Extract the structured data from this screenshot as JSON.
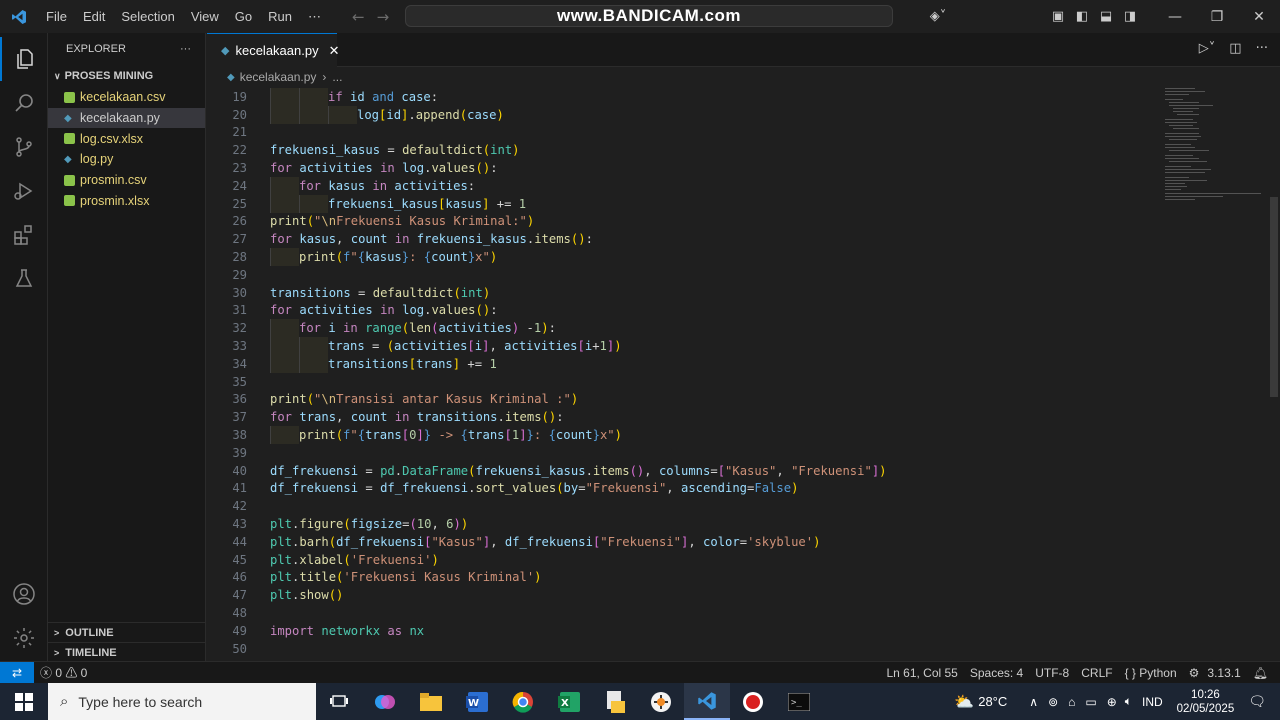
{
  "titlebar": {
    "menu": [
      "File",
      "Edit",
      "Selection",
      "View",
      "Go",
      "Run",
      "⋯"
    ],
    "command_center": "www.BANDICAM.com"
  },
  "sidebar": {
    "title": "EXPLORER",
    "folder": "PROSES MINING",
    "files": [
      {
        "name": "kecelakaan.csv",
        "type": "csv"
      },
      {
        "name": "kecelakaan.py",
        "type": "py",
        "selected": true
      },
      {
        "name": "log.csv.xlsx",
        "type": "xlsx"
      },
      {
        "name": "log.py",
        "type": "py"
      },
      {
        "name": "prosmin.csv",
        "type": "csv"
      },
      {
        "name": "prosmin.xlsx",
        "type": "xlsx"
      }
    ],
    "outline": "OUTLINE",
    "timeline": "TIMELINE"
  },
  "tab": {
    "label": "kecelakaan.py"
  },
  "breadcrumb": {
    "file": "kecelakaan.py",
    "more": "..."
  },
  "editor": {
    "lines": [
      {
        "n": "19",
        "indent": 2,
        "html": "<span class=\"ctl\">if</span> <span class=\"var\">id</span> <span class=\"bool\">and</span> <span class=\"var\">case</span>:"
      },
      {
        "n": "20",
        "indent": 3,
        "html": "<span class=\"var\">log</span><span class=\"br\">[</span><span class=\"var\">id</span><span class=\"br\">]</span>.<span class=\"fn\">append</span><span class=\"br\">(</span><span class=\"var\">case</span><span class=\"br\">)</span>"
      },
      {
        "n": "21",
        "indent": 0,
        "html": ""
      },
      {
        "n": "22",
        "indent": 0,
        "html": "<span class=\"var\">frekuensi_kasus</span> = <span class=\"fn\">defaultdict</span><span class=\"br\">(</span><span class=\"cls\">int</span><span class=\"br\">)</span>"
      },
      {
        "n": "23",
        "indent": 0,
        "html": "<span class=\"ctl\">for</span> <span class=\"var\">activities</span> <span class=\"ctl\">in</span> <span class=\"var\">log</span>.<span class=\"fn\">values</span><span class=\"br\">()</span>:"
      },
      {
        "n": "24",
        "indent": 1,
        "html": "<span class=\"ctl\">for</span> <span class=\"var\">kasus</span> <span class=\"ctl\">in</span> <span class=\"var\">activities</span>:"
      },
      {
        "n": "25",
        "indent": 2,
        "html": "<span class=\"var\">frekuensi_kasus</span><span class=\"br\">[</span><span class=\"var\">kasus</span><span class=\"br\">]</span> += <span class=\"num\">1</span>"
      },
      {
        "n": "26",
        "indent": 0,
        "html": "<span class=\"fn\">print</span><span class=\"br\">(</span><span class=\"str\">\"</span><span class=\"esc\">\\n</span><span class=\"str\">Frekuensi Kasus Kriminal:\"</span><span class=\"br\">)</span>"
      },
      {
        "n": "27",
        "indent": 0,
        "html": "<span class=\"ctl\">for</span> <span class=\"var\">kasus</span>, <span class=\"var\">count</span> <span class=\"ctl\">in</span> <span class=\"var\">frekuensi_kasus</span>.<span class=\"fn\">items</span><span class=\"br\">()</span>:"
      },
      {
        "n": "28",
        "indent": 1,
        "html": "<span class=\"fn\">print</span><span class=\"br\">(</span><span class=\"bool\">f</span><span class=\"str\">\"</span><span class=\"bool\">{</span><span class=\"var\">kasus</span><span class=\"bool\">}</span><span class=\"str\">: </span><span class=\"bool\">{</span><span class=\"var\">count</span><span class=\"bool\">}</span><span class=\"str\">x\"</span><span class=\"br\">)</span>"
      },
      {
        "n": "29",
        "indent": 0,
        "html": ""
      },
      {
        "n": "30",
        "indent": 0,
        "html": "<span class=\"var\">transitions</span> = <span class=\"fn\">defaultdict</span><span class=\"br\">(</span><span class=\"cls\">int</span><span class=\"br\">)</span>"
      },
      {
        "n": "31",
        "indent": 0,
        "html": "<span class=\"ctl\">for</span> <span class=\"var\">activities</span> <span class=\"ctl\">in</span> <span class=\"var\">log</span>.<span class=\"fn\">values</span><span class=\"br\">()</span>:"
      },
      {
        "n": "32",
        "indent": 1,
        "html": "<span class=\"ctl\">for</span> <span class=\"var\">i</span> <span class=\"ctl\">in</span> <span class=\"cls\">range</span><span class=\"br\">(</span><span class=\"fn\">len</span><span class=\"br2\">(</span><span class=\"var\">activities</span><span class=\"br2\">)</span> -<span class=\"num\">1</span><span class=\"br\">)</span>:"
      },
      {
        "n": "33",
        "indent": 2,
        "html": "<span class=\"var\">trans</span> = <span class=\"br\">(</span><span class=\"var\">activities</span><span class=\"br2\">[</span><span class=\"var\">i</span><span class=\"br2\">]</span>, <span class=\"var\">activities</span><span class=\"br2\">[</span><span class=\"var\">i</span>+<span class=\"num\">1</span><span class=\"br2\">]</span><span class=\"br\">)</span>"
      },
      {
        "n": "34",
        "indent": 2,
        "html": "<span class=\"var\">transitions</span><span class=\"br\">[</span><span class=\"var\">trans</span><span class=\"br\">]</span> += <span class=\"num\">1</span>"
      },
      {
        "n": "35",
        "indent": 0,
        "html": ""
      },
      {
        "n": "36",
        "indent": 0,
        "html": "<span class=\"fn\">print</span><span class=\"br\">(</span><span class=\"str\">\"</span><span class=\"esc\">\\n</span><span class=\"str\">Transisi antar Kasus Kriminal :\"</span><span class=\"br\">)</span>"
      },
      {
        "n": "37",
        "indent": 0,
        "html": "<span class=\"ctl\">for</span> <span class=\"var\">trans</span>, <span class=\"var\">count</span> <span class=\"ctl\">in</span> <span class=\"var\">transitions</span>.<span class=\"fn\">items</span><span class=\"br\">()</span>:"
      },
      {
        "n": "38",
        "indent": 1,
        "html": "<span class=\"fn\">print</span><span class=\"br\">(</span><span class=\"bool\">f</span><span class=\"str\">\"</span><span class=\"bool\">{</span><span class=\"var\">trans</span><span class=\"br2\">[</span><span class=\"num\">0</span><span class=\"br2\">]</span><span class=\"bool\">}</span><span class=\"str\"> -&gt; </span><span class=\"bool\">{</span><span class=\"var\">trans</span><span class=\"br2\">[</span><span class=\"num\">1</span><span class=\"br2\">]</span><span class=\"bool\">}</span><span class=\"str\">: </span><span class=\"bool\">{</span><span class=\"var\">count</span><span class=\"bool\">}</span><span class=\"str\">x\"</span><span class=\"br\">)</span>"
      },
      {
        "n": "39",
        "indent": 0,
        "html": ""
      },
      {
        "n": "40",
        "indent": 0,
        "html": "<span class=\"var\">df_frekuensi</span> = <span class=\"cls\">pd</span>.<span class=\"cls\">DataFrame</span><span class=\"br\">(</span><span class=\"var\">frekuensi_kasus</span>.<span class=\"fn\">items</span><span class=\"br2\">()</span>, <span class=\"var\">columns</span>=<span class=\"br2\">[</span><span class=\"str\">\"Kasus\"</span>, <span class=\"str\">\"Frekuensi\"</span><span class=\"br2\">]</span><span class=\"br\">)</span>"
      },
      {
        "n": "41",
        "indent": 0,
        "html": "<span class=\"var\">df_frekuensi</span> = <span class=\"var\">df_frekuensi</span>.<span class=\"fn\">sort_values</span><span class=\"br\">(</span><span class=\"var\">by</span>=<span class=\"str\">\"Frekuensi\"</span>, <span class=\"var\">ascending</span>=<span class=\"bool\">False</span><span class=\"br\">)</span>"
      },
      {
        "n": "42",
        "indent": 0,
        "html": ""
      },
      {
        "n": "43",
        "indent": 0,
        "html": "<span class=\"cls\">plt</span>.<span class=\"fn\">figure</span><span class=\"br\">(</span><span class=\"var\">figsize</span>=<span class=\"br2\">(</span><span class=\"num\">10</span>, <span class=\"num\">6</span><span class=\"br2\">)</span><span class=\"br\">)</span>"
      },
      {
        "n": "44",
        "indent": 0,
        "html": "<span class=\"cls\">plt</span>.<span class=\"fn\">barh</span><span class=\"br\">(</span><span class=\"var\">df_frekuensi</span><span class=\"br2\">[</span><span class=\"str\">\"Kasus\"</span><span class=\"br2\">]</span>, <span class=\"var\">df_frekuensi</span><span class=\"br2\">[</span><span class=\"str\">\"Frekuensi\"</span><span class=\"br2\">]</span>, <span class=\"var\">color</span>=<span class=\"str\">'skyblue'</span><span class=\"br\">)</span>"
      },
      {
        "n": "45",
        "indent": 0,
        "html": "<span class=\"cls\">plt</span>.<span class=\"fn\">xlabel</span><span class=\"br\">(</span><span class=\"str\">'Frekuensi'</span><span class=\"br\">)</span>"
      },
      {
        "n": "46",
        "indent": 0,
        "html": "<span class=\"cls\">plt</span>.<span class=\"fn\">title</span><span class=\"br\">(</span><span class=\"str\">'Frekuensi Kasus Kriminal'</span><span class=\"br\">)</span>"
      },
      {
        "n": "47",
        "indent": 0,
        "html": "<span class=\"cls\">plt</span>.<span class=\"fn\">show</span><span class=\"br\">()</span>"
      },
      {
        "n": "48",
        "indent": 0,
        "html": ""
      },
      {
        "n": "49",
        "indent": 0,
        "html": "<span class=\"kw\">import</span> <span class=\"cls\">networkx</span> <span class=\"kw\">as</span> <span class=\"cls\">nx</span>"
      },
      {
        "n": "50",
        "indent": 0,
        "html": ""
      }
    ]
  },
  "statusbar": {
    "problems": "ⓧ 0 ⚠ 0",
    "position": "Ln 61, Col 55",
    "spaces": "Spaces: 4",
    "encoding": "UTF-8",
    "eol": "CRLF",
    "language": "{ } Python",
    "version": "3.13.1"
  },
  "taskbar": {
    "search_placeholder": "Type here to search",
    "weather": "28°C",
    "lang": "IND",
    "time": "10:26",
    "date": "02/05/2025"
  },
  "colors": {
    "accent": "#0078d4",
    "bg": "#1f1f1f"
  }
}
